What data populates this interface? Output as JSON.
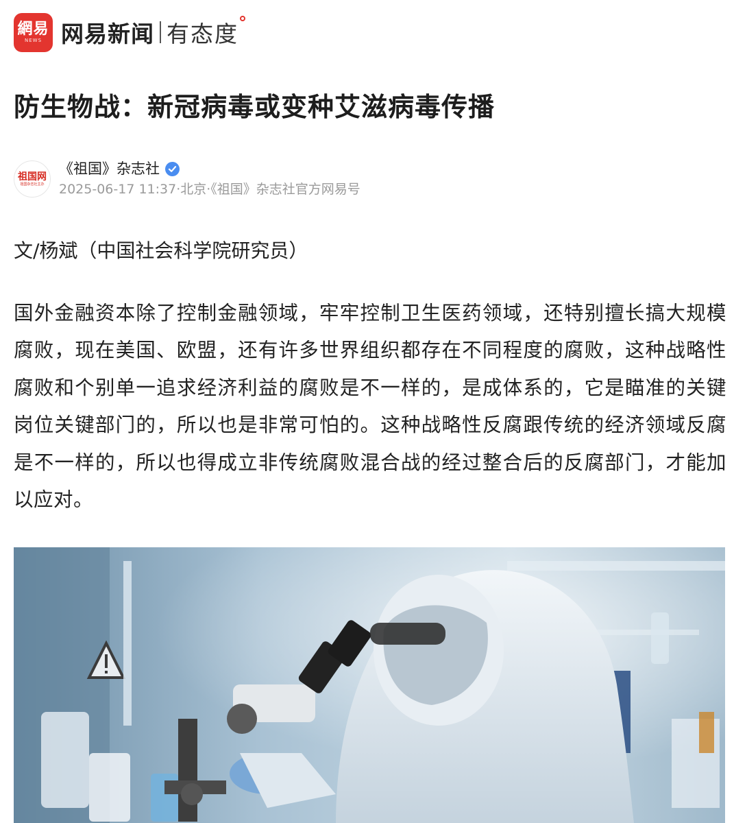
{
  "header": {
    "logo_text": "網易",
    "logo_sub": "NEWS",
    "brand_name": "网易新闻",
    "slogan": "有态度"
  },
  "article": {
    "title": "防生物战：新冠病毒或变种艾滋病毒传播",
    "author": {
      "avatar_text": "祖国网",
      "avatar_sub": "祖国杂志社主办",
      "name": "《祖国》杂志社",
      "verified": true
    },
    "publish_info": "2025-06-17 11:37·北京·《祖国》杂志社官方网易号",
    "byline": "文/杨斌（中国社会科学院研究员）",
    "body": "国外金融资本除了控制金融领域，牢牢控制卫生医药领域，还特别擅长搞大规模腐败，现在美国、欧盟，还有许多世界组织都存在不同程度的腐败，这种战略性腐败和个别单一追求经济利益的腐败是不一样的，是成体系的，它是瞄准的关键岗位关键部门的，所以也是非常可怕的。这种战略性反腐跟传统的经济领域反腐是不一样的，所以也得成立非传统腐败混合战的经过整合后的反腐部门，才能加以应对。"
  },
  "colors": {
    "brand_red": "#e3352f",
    "verify_blue": "#4a8df0",
    "meta_gray": "#9a9a9a"
  }
}
